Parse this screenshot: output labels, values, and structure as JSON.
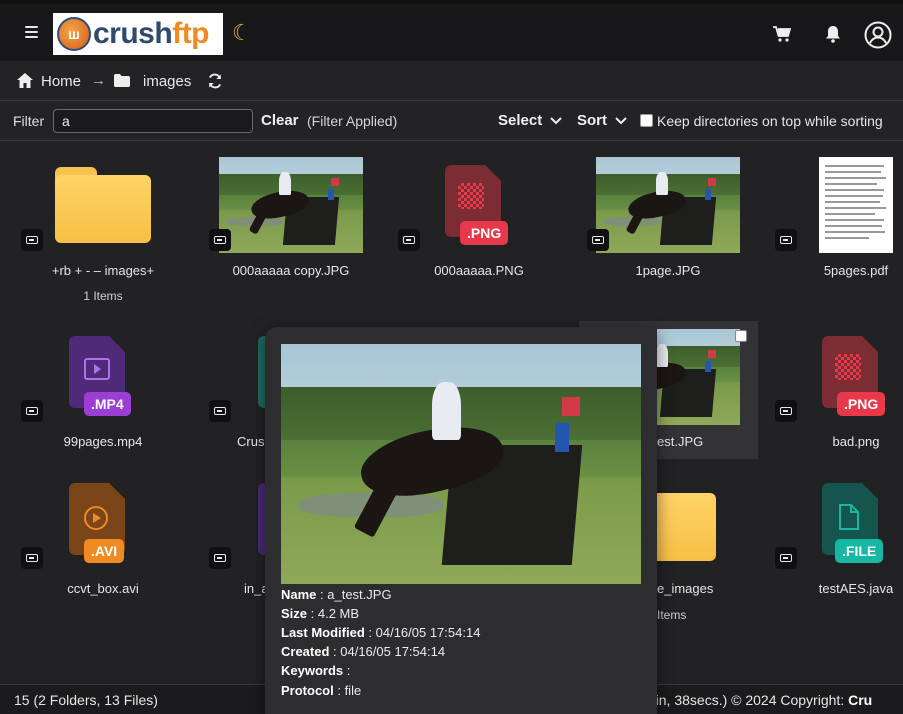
{
  "header": {
    "logo_text_a": "crush",
    "logo_text_b": "ftp",
    "logo_badge": "ш"
  },
  "breadcrumb": {
    "home": "Home",
    "arrow": "→",
    "current": "images"
  },
  "filter": {
    "label": "Filter",
    "value": "a",
    "clear_label": "Clear",
    "applied_text": "(Filter Applied)",
    "select_label": "Select",
    "sort_label": "Sort",
    "keep_dirs_label": "Keep directories on top while sorting"
  },
  "items": [
    {
      "name": "+rb + - – images+",
      "sub": "1 Items"
    },
    {
      "name": "000aaaaa copy.JPG"
    },
    {
      "name": "000aaaaa.PNG",
      "ext": ".PNG"
    },
    {
      "name": "1page.JPG"
    },
    {
      "name": "5pages.pdf"
    },
    {
      "name": "99pages.mp4",
      "ext": ".MP4"
    },
    {
      "name": "Crus"
    },
    {
      "name": "est.JPG"
    },
    {
      "name": "bad.png",
      "ext": ".PNG"
    },
    {
      "name": "ccvt_box.avi",
      "ext": ".AVI"
    },
    {
      "name": "in_a"
    },
    {
      "name": "e_images",
      "sub": "Items"
    },
    {
      "name": "testAES.java",
      "ext": ".FILE"
    }
  ],
  "tooltip": {
    "name_label": "Name",
    "name_value": " : a_test.JPG",
    "size_label": "Size",
    "size_value": " : 4.2 MB",
    "modified_label": "Last Modified",
    "modified_value": " : 04/16/05 17:54:14",
    "created_label": "Created",
    "created_value": " : 04/16/05 17:54:14",
    "keywords_label": "Keywords",
    "keywords_value": " :",
    "protocol_label": "Protocol",
    "protocol_value": " : file"
  },
  "status": {
    "left": "15 (2 Folders, 13 Files)",
    "right_prefix": "min, 38secs.) © 2024 Copyright: ",
    "right_bold": "Cru"
  },
  "colors": {
    "png_badge": "#e8394a",
    "mp4_badge": "#9a3fd1",
    "avi_badge": "#f08a22",
    "file_badge": "#16b7a4",
    "folder": "#f7c350"
  },
  "icons": [
    "menu-icon",
    "moon-icon",
    "cart-icon",
    "bell-icon",
    "user-icon",
    "home-icon",
    "folder-icon",
    "refresh-icon",
    "chevron-down-icon",
    "drive-icon"
  ]
}
